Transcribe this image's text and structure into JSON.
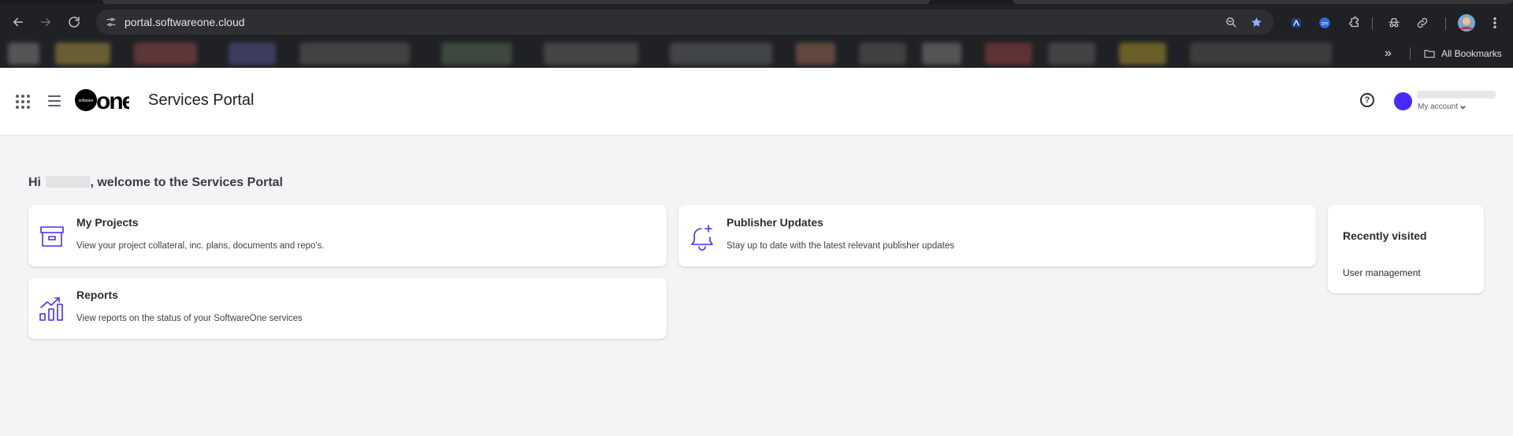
{
  "browser": {
    "url": "portal.softwareone.cloud",
    "all_bookmarks_label": "All Bookmarks",
    "more_bookmarks_label": "»"
  },
  "header": {
    "title": "Services Portal",
    "logo_text": "one",
    "logo_small_text": "software",
    "help_label": "?",
    "account_label": "My account"
  },
  "greeting": {
    "prefix": "Hi ",
    "suffix": ", welcome to the Services Portal"
  },
  "cards": {
    "projects": {
      "title": "My Projects",
      "description": "View your project collateral, inc. plans, documents and repo's."
    },
    "publisher": {
      "title": "Publisher Updates",
      "description": "Stay up to date with the latest relevant publisher updates"
    },
    "reports": {
      "title": "Reports",
      "description": "View reports on the status of your SoftwareOne services"
    }
  },
  "recently_visited": {
    "title": "Recently visited",
    "items": [
      "User management"
    ]
  },
  "colors": {
    "accent": "#472aff",
    "page_bg": "#f3f4f6",
    "chrome_bg": "#202124"
  },
  "icons": {
    "apps": "apps-grid-icon",
    "menu": "hamburger-menu-icon",
    "help": "help-circle-icon",
    "projects": "archive-box-icon",
    "publisher": "bell-plus-icon",
    "reports": "bar-chart-trend-icon"
  }
}
